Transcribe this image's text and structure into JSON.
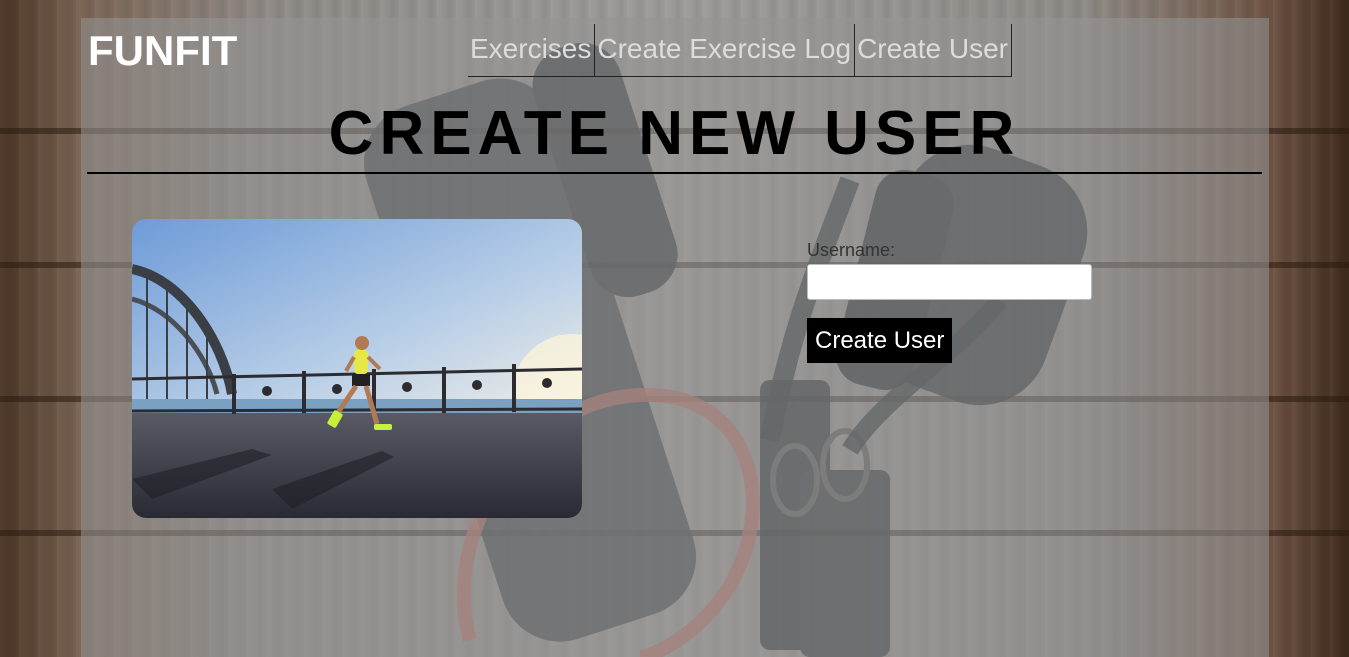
{
  "brand": {
    "title": "FUNFIT"
  },
  "nav": {
    "items": [
      {
        "label": "Exercises"
      },
      {
        "label": "Create Exercise Log"
      },
      {
        "label": "Create User"
      }
    ]
  },
  "page": {
    "title": "CREATE NEW USER"
  },
  "form": {
    "username_label": "Username:",
    "username_value": "",
    "submit_label": "Create User"
  },
  "colors": {
    "panel_overlay": "#969696",
    "button_bg": "#000000",
    "brand_text": "#ffffff",
    "nav_text": "#dcdcdc"
  },
  "icons": {
    "background": "resistance-band-background-image",
    "hero": "runner-on-bridge-photo"
  }
}
